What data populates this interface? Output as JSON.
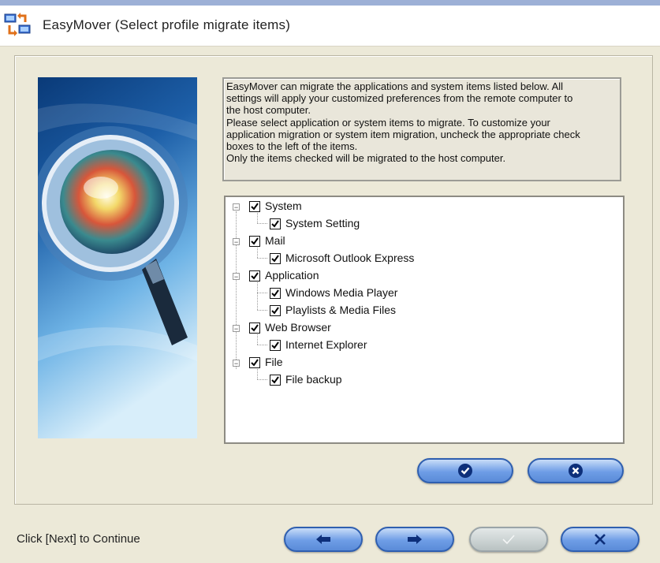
{
  "window": {
    "title": "EasyMover  (Select profile migrate items)",
    "icon": "easymover-app-icon"
  },
  "description": [
    "EasyMover  can migrate the applications and system items listed below.  All",
    "settings will apply your customized preferences from the remote computer to",
    "the host computer.",
    "Please select application or system items to migrate. To customize your",
    "application migration or system item migration, uncheck the appropriate check",
    "boxes to the left of the items.",
    "Only the items checked will be migrated to the host computer."
  ],
  "tree": [
    {
      "label": "System",
      "checked": true,
      "expanded": true,
      "children": [
        {
          "label": "System Setting",
          "checked": true
        }
      ]
    },
    {
      "label": "Mail",
      "checked": true,
      "expanded": true,
      "children": [
        {
          "label": "Microsoft Outlook Express",
          "checked": true
        }
      ]
    },
    {
      "label": "Application",
      "checked": true,
      "expanded": true,
      "children": [
        {
          "label": "Windows Media Player",
          "checked": true
        },
        {
          "label": "Playlists & Media Files",
          "checked": true
        }
      ]
    },
    {
      "label": "Web Browser",
      "checked": true,
      "expanded": true,
      "children": [
        {
          "label": "Internet Explorer",
          "checked": true
        }
      ]
    },
    {
      "label": "File",
      "checked": true,
      "expanded": true,
      "children": [
        {
          "label": "File backup",
          "checked": true
        }
      ]
    }
  ],
  "buttons": {
    "select_all": {
      "icon": "check-circle-icon"
    },
    "clear_all": {
      "icon": "x-circle-icon"
    },
    "back": {
      "icon": "arrow-left-icon"
    },
    "next": {
      "icon": "arrow-right-icon"
    },
    "finish": {
      "icon": "checkmark-icon",
      "enabled": false
    },
    "cancel": {
      "icon": "x-icon"
    }
  },
  "status": "Click [Next] to Continue",
  "colors": {
    "button_blue": "#5a8bd8",
    "button_border": "#2f5fb0",
    "dialog_bg": "#ece9d8"
  }
}
